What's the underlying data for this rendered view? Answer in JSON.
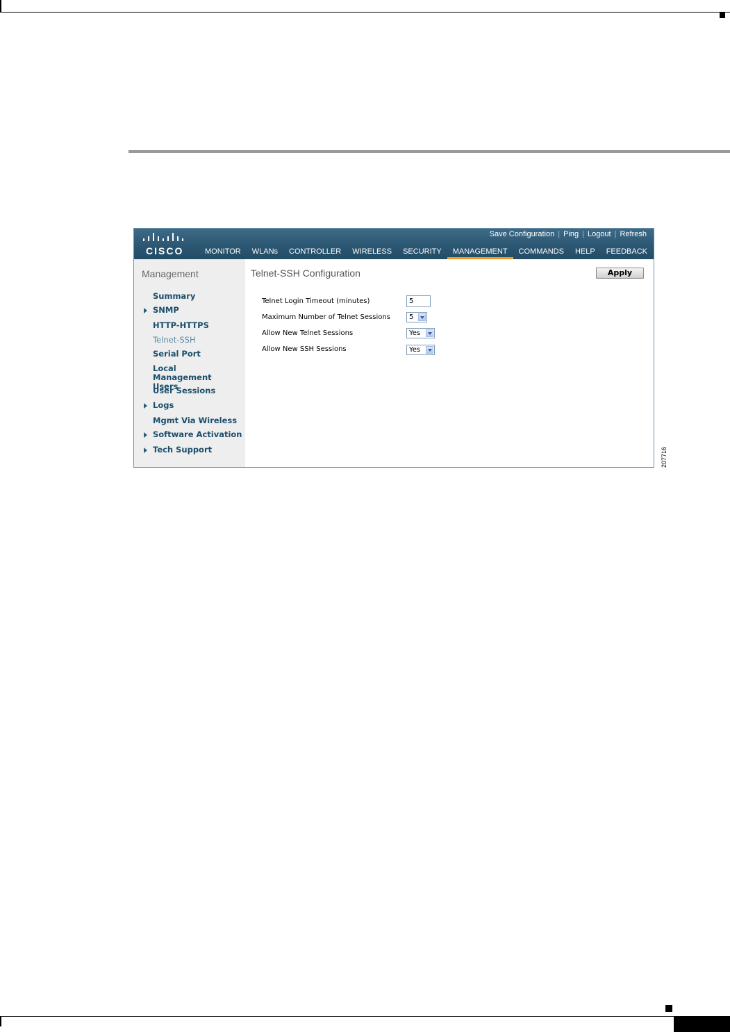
{
  "figure_number": "207716",
  "header": {
    "brand": "CISCO",
    "util_links": [
      "Save Configuration",
      "Ping",
      "Logout",
      "Refresh"
    ],
    "nav": [
      "MONITOR",
      "WLANs",
      "CONTROLLER",
      "WIRELESS",
      "SECURITY",
      "MANAGEMENT",
      "COMMANDS",
      "HELP",
      "FEEDBACK"
    ],
    "active_nav": "MANAGEMENT",
    "accent_color": "#f29a1d"
  },
  "sidebar": {
    "title": "Management",
    "items": [
      {
        "label": "Summary",
        "expandable": false
      },
      {
        "label": "SNMP",
        "expandable": true
      },
      {
        "label": "HTTP-HTTPS",
        "expandable": false
      },
      {
        "label": "Telnet-SSH",
        "expandable": false,
        "current": true
      },
      {
        "label": "Serial Port",
        "expandable": false
      },
      {
        "label": "Local Management Users",
        "expandable": false
      },
      {
        "label": "User Sessions",
        "expandable": false
      },
      {
        "label": "Logs",
        "expandable": true
      },
      {
        "label": "Mgmt Via Wireless",
        "expandable": false
      },
      {
        "label": "Software Activation",
        "expandable": true
      },
      {
        "label": "Tech Support",
        "expandable": true
      }
    ]
  },
  "main": {
    "title": "Telnet-SSH Configuration",
    "apply_label": "Apply",
    "fields": {
      "timeout_label": "Telnet Login Timeout (minutes)",
      "timeout_value": "5",
      "max_sessions_label": "Maximum Number of Telnet Sessions",
      "max_sessions_value": "5",
      "allow_telnet_label": "Allow New Telnet Sessions",
      "allow_telnet_value": "Yes",
      "allow_ssh_label": "Allow New SSH Sessions",
      "allow_ssh_value": "Yes"
    }
  }
}
